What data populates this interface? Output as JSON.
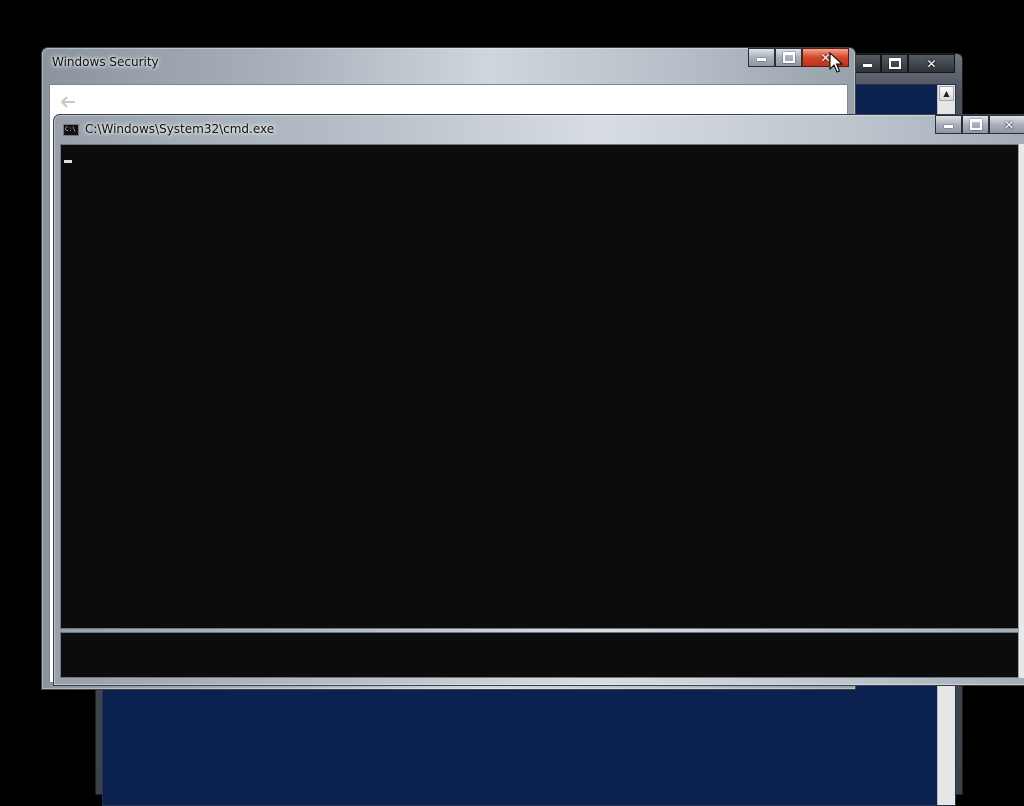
{
  "windows": {
    "background": {
      "minimize_glyph": "minimize",
      "maximize_glyph": "maximize",
      "close_glyph": "✕",
      "scroll_up_glyph": "▲",
      "content_color": "#0b2150"
    },
    "security": {
      "title": "Windows Security",
      "back_glyph": "🡐",
      "close_glyph": "✕",
      "close_state": "hovered"
    },
    "cmd": {
      "title": "C:\\Windows\\System32\\cmd.exe",
      "icon_text": "C:\\",
      "console_color": "#0c0c0c",
      "close_glyph": "✕"
    }
  },
  "pointer": {
    "icon": "arrow-cursor"
  }
}
